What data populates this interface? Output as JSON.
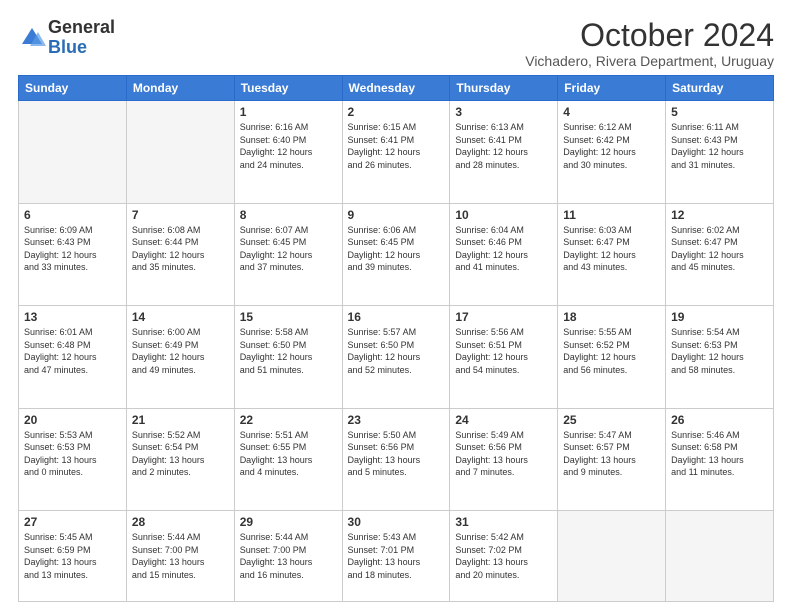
{
  "logo": {
    "general": "General",
    "blue": "Blue"
  },
  "title": "October 2024",
  "subtitle": "Vichadero, Rivera Department, Uruguay",
  "days_header": [
    "Sunday",
    "Monday",
    "Tuesday",
    "Wednesday",
    "Thursday",
    "Friday",
    "Saturday"
  ],
  "weeks": [
    [
      {
        "day": "",
        "info": "",
        "empty": true
      },
      {
        "day": "",
        "info": "",
        "empty": true
      },
      {
        "day": "1",
        "info": "Sunrise: 6:16 AM\nSunset: 6:40 PM\nDaylight: 12 hours\nand 24 minutes."
      },
      {
        "day": "2",
        "info": "Sunrise: 6:15 AM\nSunset: 6:41 PM\nDaylight: 12 hours\nand 26 minutes."
      },
      {
        "day": "3",
        "info": "Sunrise: 6:13 AM\nSunset: 6:41 PM\nDaylight: 12 hours\nand 28 minutes."
      },
      {
        "day": "4",
        "info": "Sunrise: 6:12 AM\nSunset: 6:42 PM\nDaylight: 12 hours\nand 30 minutes."
      },
      {
        "day": "5",
        "info": "Sunrise: 6:11 AM\nSunset: 6:43 PM\nDaylight: 12 hours\nand 31 minutes."
      }
    ],
    [
      {
        "day": "6",
        "info": "Sunrise: 6:09 AM\nSunset: 6:43 PM\nDaylight: 12 hours\nand 33 minutes."
      },
      {
        "day": "7",
        "info": "Sunrise: 6:08 AM\nSunset: 6:44 PM\nDaylight: 12 hours\nand 35 minutes."
      },
      {
        "day": "8",
        "info": "Sunrise: 6:07 AM\nSunset: 6:45 PM\nDaylight: 12 hours\nand 37 minutes."
      },
      {
        "day": "9",
        "info": "Sunrise: 6:06 AM\nSunset: 6:45 PM\nDaylight: 12 hours\nand 39 minutes."
      },
      {
        "day": "10",
        "info": "Sunrise: 6:04 AM\nSunset: 6:46 PM\nDaylight: 12 hours\nand 41 minutes."
      },
      {
        "day": "11",
        "info": "Sunrise: 6:03 AM\nSunset: 6:47 PM\nDaylight: 12 hours\nand 43 minutes."
      },
      {
        "day": "12",
        "info": "Sunrise: 6:02 AM\nSunset: 6:47 PM\nDaylight: 12 hours\nand 45 minutes."
      }
    ],
    [
      {
        "day": "13",
        "info": "Sunrise: 6:01 AM\nSunset: 6:48 PM\nDaylight: 12 hours\nand 47 minutes."
      },
      {
        "day": "14",
        "info": "Sunrise: 6:00 AM\nSunset: 6:49 PM\nDaylight: 12 hours\nand 49 minutes."
      },
      {
        "day": "15",
        "info": "Sunrise: 5:58 AM\nSunset: 6:50 PM\nDaylight: 12 hours\nand 51 minutes."
      },
      {
        "day": "16",
        "info": "Sunrise: 5:57 AM\nSunset: 6:50 PM\nDaylight: 12 hours\nand 52 minutes."
      },
      {
        "day": "17",
        "info": "Sunrise: 5:56 AM\nSunset: 6:51 PM\nDaylight: 12 hours\nand 54 minutes."
      },
      {
        "day": "18",
        "info": "Sunrise: 5:55 AM\nSunset: 6:52 PM\nDaylight: 12 hours\nand 56 minutes."
      },
      {
        "day": "19",
        "info": "Sunrise: 5:54 AM\nSunset: 6:53 PM\nDaylight: 12 hours\nand 58 minutes."
      }
    ],
    [
      {
        "day": "20",
        "info": "Sunrise: 5:53 AM\nSunset: 6:53 PM\nDaylight: 13 hours\nand 0 minutes."
      },
      {
        "day": "21",
        "info": "Sunrise: 5:52 AM\nSunset: 6:54 PM\nDaylight: 13 hours\nand 2 minutes."
      },
      {
        "day": "22",
        "info": "Sunrise: 5:51 AM\nSunset: 6:55 PM\nDaylight: 13 hours\nand 4 minutes."
      },
      {
        "day": "23",
        "info": "Sunrise: 5:50 AM\nSunset: 6:56 PM\nDaylight: 13 hours\nand 5 minutes."
      },
      {
        "day": "24",
        "info": "Sunrise: 5:49 AM\nSunset: 6:56 PM\nDaylight: 13 hours\nand 7 minutes."
      },
      {
        "day": "25",
        "info": "Sunrise: 5:47 AM\nSunset: 6:57 PM\nDaylight: 13 hours\nand 9 minutes."
      },
      {
        "day": "26",
        "info": "Sunrise: 5:46 AM\nSunset: 6:58 PM\nDaylight: 13 hours\nand 11 minutes."
      }
    ],
    [
      {
        "day": "27",
        "info": "Sunrise: 5:45 AM\nSunset: 6:59 PM\nDaylight: 13 hours\nand 13 minutes."
      },
      {
        "day": "28",
        "info": "Sunrise: 5:44 AM\nSunset: 7:00 PM\nDaylight: 13 hours\nand 15 minutes."
      },
      {
        "day": "29",
        "info": "Sunrise: 5:44 AM\nSunset: 7:00 PM\nDaylight: 13 hours\nand 16 minutes."
      },
      {
        "day": "30",
        "info": "Sunrise: 5:43 AM\nSunset: 7:01 PM\nDaylight: 13 hours\nand 18 minutes."
      },
      {
        "day": "31",
        "info": "Sunrise: 5:42 AM\nSunset: 7:02 PM\nDaylight: 13 hours\nand 20 minutes."
      },
      {
        "day": "",
        "info": "",
        "empty": true
      },
      {
        "day": "",
        "info": "",
        "empty": true
      }
    ]
  ]
}
